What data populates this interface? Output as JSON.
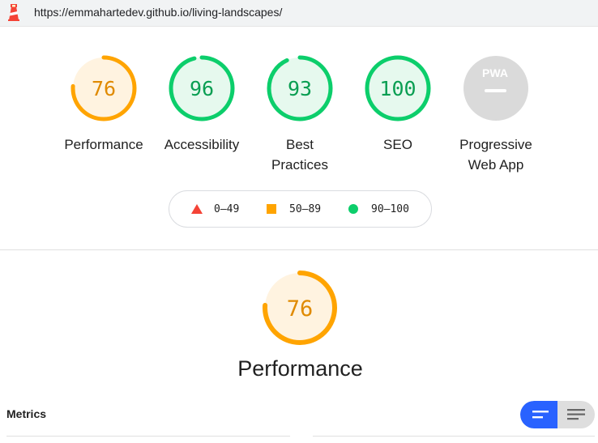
{
  "address_bar": {
    "url": "https://emmahartedev.github.io/living-landscapes/"
  },
  "categories": [
    {
      "label": "Performance",
      "score": "76",
      "score_fraction": 0.76,
      "rating": "average"
    },
    {
      "label": "Accessibility",
      "score": "96",
      "score_fraction": 0.96,
      "rating": "pass"
    },
    {
      "label": "Best Practices",
      "score": "93",
      "score_fraction": 0.93,
      "rating": "pass"
    },
    {
      "label": "SEO",
      "score": "100",
      "score_fraction": 1.0,
      "rating": "pass"
    },
    {
      "label": "Progressive Web App",
      "badge_text": "PWA",
      "rating": "na"
    }
  ],
  "legend": [
    {
      "shape": "triangle",
      "range": "0–49",
      "color": "#f44336"
    },
    {
      "shape": "square",
      "range": "50–89",
      "color": "#ffa400"
    },
    {
      "shape": "circle",
      "range": "90–100",
      "color": "#0cce6b"
    }
  ],
  "performance_section": {
    "score": "76",
    "score_fraction": 0.76,
    "title": "Performance"
  },
  "metrics": {
    "heading": "Metrics",
    "view_toggle_active": "compact"
  },
  "colors": {
    "pass": "#0cce6b",
    "pass_text": "#008800",
    "pass_bg": "#e6f9ee",
    "average": "#ffa400",
    "average_text": "#c33300",
    "average_bg": "#fff3e0",
    "fail": "#f44336",
    "na": "#d9d9d9",
    "toggle_active": "#2962ff"
  }
}
